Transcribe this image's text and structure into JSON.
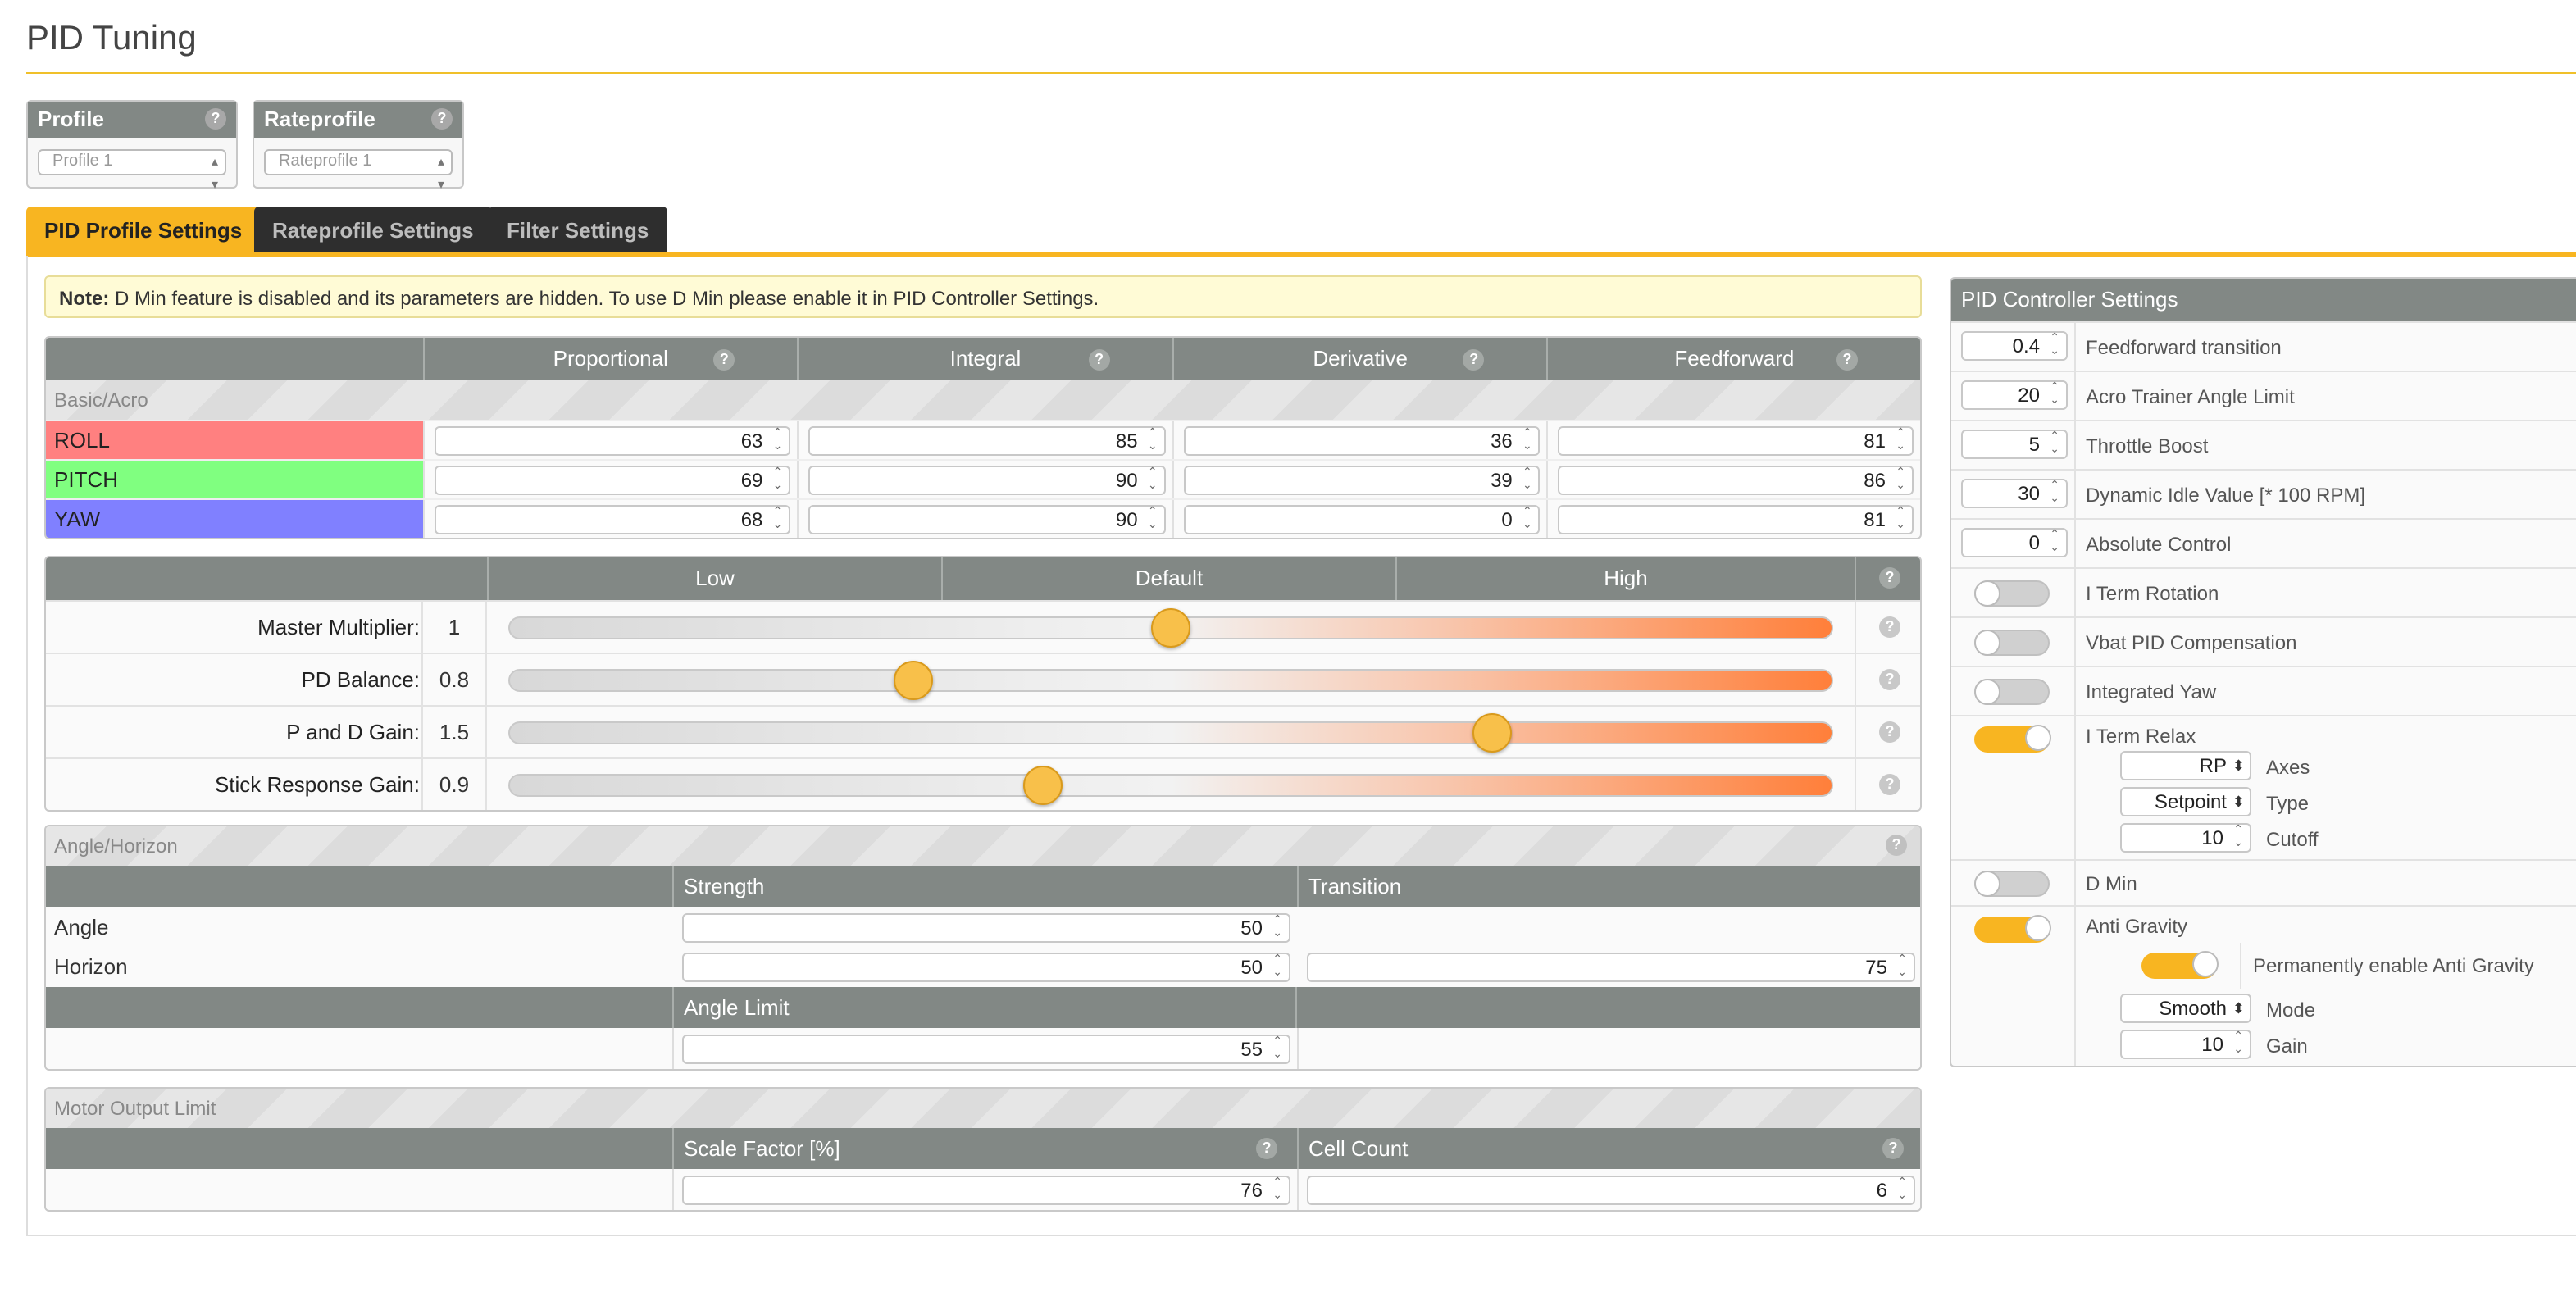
{
  "page": {
    "title": "PID Tuning"
  },
  "profile": {
    "label": "Profile",
    "value": "Profile 1"
  },
  "rateprofile": {
    "label": "Rateprofile",
    "value": "Rateprofile 1"
  },
  "tabs": [
    {
      "label": "PID Profile Settings",
      "active": true
    },
    {
      "label": "Rateprofile Settings",
      "active": false
    },
    {
      "label": "Filter Settings",
      "active": false
    }
  ],
  "note": {
    "prefix": "Note:",
    "text": "D Min feature is disabled and its parameters are hidden. To use D Min please enable it in PID Controller Settings."
  },
  "pid_table": {
    "columns": [
      "Proportional",
      "Integral",
      "Derivative",
      "Feedforward"
    ],
    "section": "Basic/Acro",
    "rows": [
      {
        "axis": "ROLL",
        "color": "#ff8080",
        "values": [
          "63",
          "85",
          "36",
          "81"
        ]
      },
      {
        "axis": "PITCH",
        "color": "#80ff80",
        "values": [
          "69",
          "90",
          "39",
          "86"
        ]
      },
      {
        "axis": "YAW",
        "color": "#8080ff",
        "values": [
          "68",
          "90",
          "0",
          "81"
        ]
      }
    ]
  },
  "sliders": {
    "headers": {
      "low": "Low",
      "default": "Default",
      "high": "High"
    },
    "rows": [
      {
        "label": "Master Multiplier:",
        "value": "1",
        "position": 0.5
      },
      {
        "label": "PD Balance:",
        "value": "0.8",
        "position": 0.306
      },
      {
        "label": "P and D Gain:",
        "value": "1.5",
        "position": 0.742
      },
      {
        "label": "Stick Response Gain:",
        "value": "0.9",
        "position": 0.403
      }
    ]
  },
  "angle_horizon": {
    "title": "Angle/Horizon",
    "strength_label": "Strength",
    "transition_label": "Transition",
    "angle_label": "Angle",
    "horizon_label": "Horizon",
    "angle_strength": "50",
    "horizon_strength": "50",
    "horizon_transition": "75",
    "angle_limit_label": "Angle Limit",
    "angle_limit": "55"
  },
  "motor_output": {
    "title": "Motor Output Limit",
    "scale_label": "Scale Factor [%]",
    "cell_label": "Cell Count",
    "scale_value": "76",
    "cell_value": "6"
  },
  "controller": {
    "title": "PID Controller Settings",
    "feedforward_transition": {
      "value": "0.4",
      "label": "Feedforward transition"
    },
    "acro_trainer": {
      "value": "20",
      "label": "Acro Trainer Angle Limit"
    },
    "throttle_boost": {
      "value": "5",
      "label": "Throttle Boost"
    },
    "dynamic_idle": {
      "value": "30",
      "label": "Dynamic Idle Value [* 100 RPM]"
    },
    "absolute_control": {
      "value": "0",
      "label": "Absolute Control"
    },
    "iterm_rotation": {
      "label": "I Term Rotation",
      "enabled": false
    },
    "vbat_comp": {
      "label": "Vbat PID Compensation",
      "enabled": false
    },
    "integrated_yaw": {
      "label": "Integrated Yaw",
      "enabled": false
    },
    "iterm_relax": {
      "label": "I Term Relax",
      "enabled": true,
      "axes_value": "RP",
      "axes_label": "Axes",
      "type_value": "Setpoint",
      "type_label": "Type",
      "cutoff_value": "10",
      "cutoff_label": "Cutoff"
    },
    "dmin": {
      "label": "D Min",
      "enabled": false
    },
    "anti_gravity": {
      "label": "Anti Gravity",
      "enabled": true,
      "permanent_label": "Permanently enable Anti Gravity",
      "permanent_enabled": true,
      "mode_value": "Smooth",
      "mode_label": "Mode",
      "gain_value": "10",
      "gain_label": "Gain"
    }
  },
  "icons": {
    "help": "?",
    "spinner": "⌃⌄",
    "select_arrow": "▴▾"
  }
}
